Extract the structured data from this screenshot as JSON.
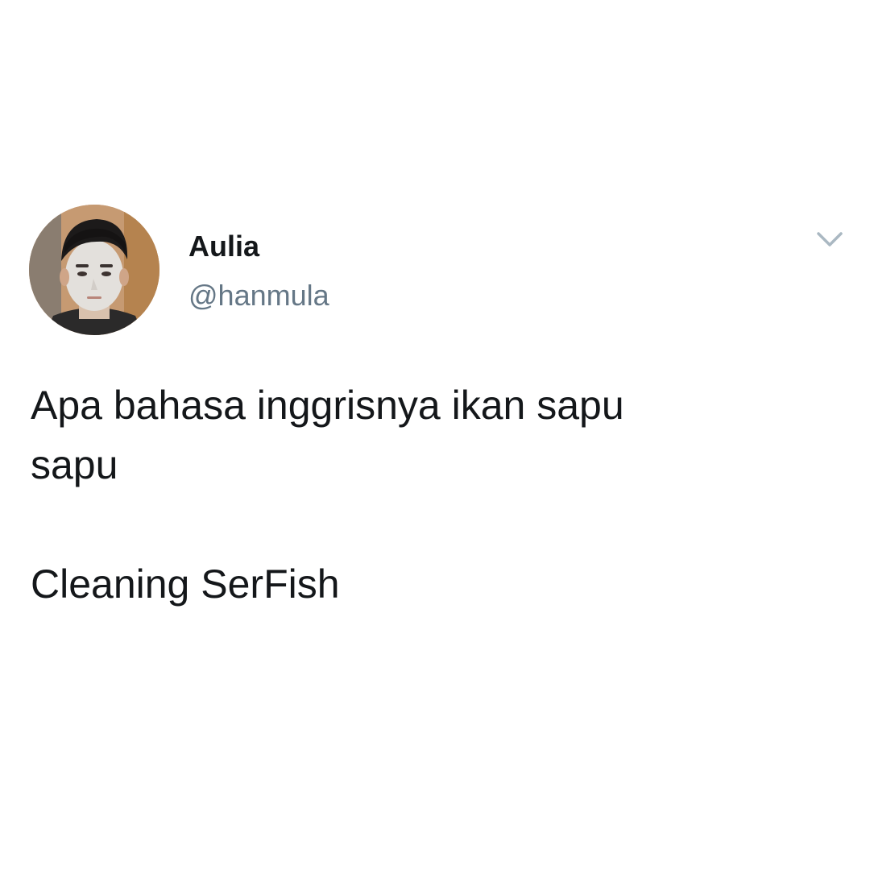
{
  "tweet": {
    "author": {
      "display_name": "Aulia",
      "handle": "@hanmula",
      "avatar_icon": "profile-photo"
    },
    "menu_icon": "chevron-down-icon",
    "text": {
      "line1": "Apa bahasa inggrisnya ikan sapu",
      "line2": "sapu",
      "line3": "Cleaning SerFish"
    }
  },
  "colors": {
    "background": "#ffffff",
    "text_primary": "#14171a",
    "text_secondary": "#657786",
    "caret": "#aab8c2"
  }
}
